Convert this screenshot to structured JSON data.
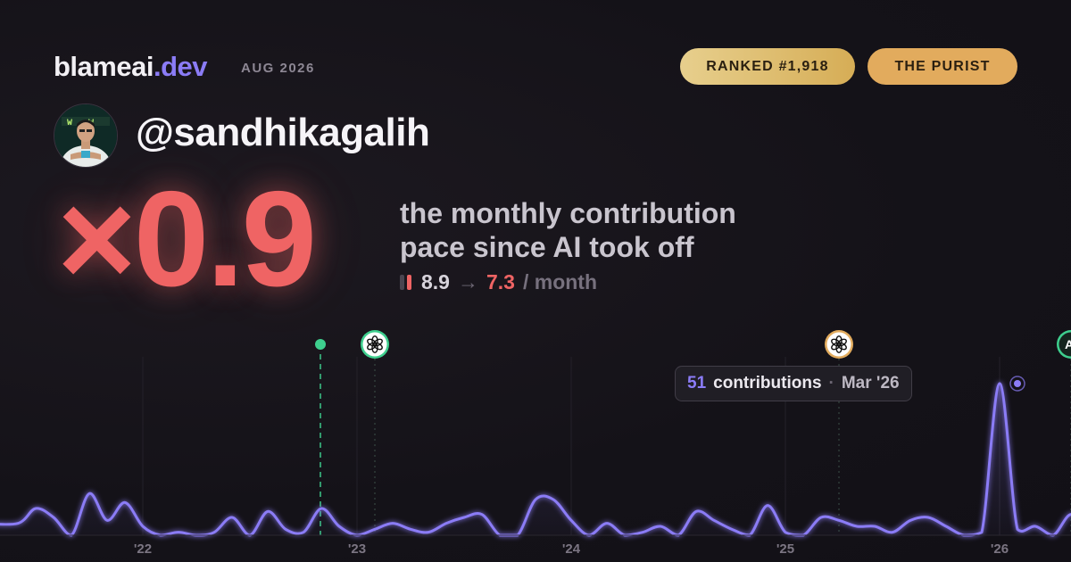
{
  "brand": {
    "name": "blameai",
    "tld": ".dev"
  },
  "date": "AUG 2026",
  "badges": {
    "rank": "RANKED #1,918",
    "persona": "THE PURIST"
  },
  "user": {
    "handle": "@sandhikagalih"
  },
  "headline": {
    "multiplier": "×0.9",
    "line1": "the monthly contribution",
    "line2": "pace since AI took off"
  },
  "pace": {
    "before": "8.9",
    "arrow": "→",
    "after": "7.3",
    "unit": "/ month"
  },
  "colors": {
    "accent": "#8b7cf6",
    "negative": "#ef6464",
    "gold": "#e2ab5d",
    "openai_marker": "#3ecf8e",
    "anthropic_marker": "#3ecf8e"
  },
  "tooltip": {
    "value": "51",
    "label": "contributions",
    "separator": "·",
    "month": "Mar '26"
  },
  "markers": [
    {
      "name": "AI takeoff",
      "icon": "dot",
      "date": "2022-12"
    },
    {
      "name": "openai",
      "icon": "openai-icon",
      "date": "2023-03"
    },
    {
      "name": "openai",
      "icon": "openai-icon",
      "date": "2025-05"
    },
    {
      "name": "anthropic",
      "icon": "anthropic-icon",
      "date": "2026-06",
      "text": "A\\"
    }
  ],
  "chart_data": {
    "type": "area",
    "x_ticks": [
      "'22",
      "'23",
      "'24",
      "'25",
      "'26"
    ],
    "x": [
      "2021-07",
      "2021-08",
      "2021-09",
      "2021-10",
      "2021-11",
      "2021-12",
      "2022-01",
      "2022-02",
      "2022-03",
      "2022-04",
      "2022-05",
      "2022-06",
      "2022-07",
      "2022-08",
      "2022-09",
      "2022-10",
      "2022-11",
      "2022-12",
      "2023-01",
      "2023-02",
      "2023-03",
      "2023-04",
      "2023-05",
      "2023-06",
      "2023-07",
      "2023-08",
      "2023-09",
      "2023-10",
      "2023-11",
      "2023-12",
      "2024-01",
      "2024-02",
      "2024-03",
      "2024-04",
      "2024-05",
      "2024-06",
      "2024-07",
      "2024-08",
      "2024-09",
      "2024-10",
      "2024-11",
      "2024-12",
      "2025-01",
      "2025-02",
      "2025-03",
      "2025-04",
      "2025-05",
      "2025-06",
      "2025-07",
      "2025-08",
      "2025-09",
      "2025-10",
      "2025-11",
      "2025-12",
      "2026-01",
      "2026-02",
      "2026-03",
      "2026-04",
      "2026-05",
      "2026-06",
      "2026-07",
      "2026-08"
    ],
    "values": [
      4,
      9,
      6,
      0,
      14,
      5,
      11,
      3,
      0,
      1,
      0,
      1,
      6,
      0,
      8,
      2,
      1,
      9,
      3,
      0,
      2,
      4,
      2,
      1,
      4,
      6,
      7,
      0,
      0,
      12,
      12,
      5,
      0,
      4,
      0,
      1,
      3,
      0,
      8,
      5,
      2,
      0,
      10,
      1,
      0,
      6,
      5,
      3,
      3,
      1,
      5,
      6,
      3,
      0,
      1,
      51,
      2,
      3,
      0,
      7,
      1,
      0
    ],
    "highlight": {
      "x": "2026-03",
      "value": 51
    }
  }
}
